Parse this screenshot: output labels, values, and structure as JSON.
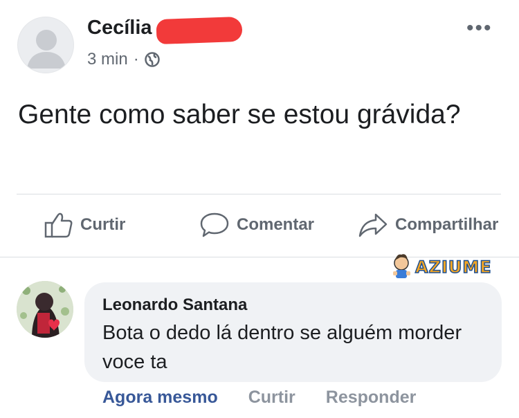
{
  "post": {
    "author": "Cecília",
    "time": "3 min",
    "separator": "·",
    "privacy_icon": "globe-icon",
    "more_icon": "more-dots-icon",
    "more_label": "•••",
    "text": "Gente como saber se estou grávida?"
  },
  "actions": {
    "like_label": "Curtir",
    "comment_label": "Comentar",
    "share_label": "Compartilhar"
  },
  "watermark": {
    "text": "AZIUME"
  },
  "comment": {
    "author": "Leonardo Santana",
    "text": "Bota o dedo lá dentro se alguém morder voce ta",
    "time": "Agora mesmo",
    "like_label": "Curtir",
    "reply_label": "Responder"
  },
  "colors": {
    "link": "#385898",
    "muted": "#606770",
    "redaction": "#f23a3a",
    "bubble": "#f0f2f5"
  }
}
